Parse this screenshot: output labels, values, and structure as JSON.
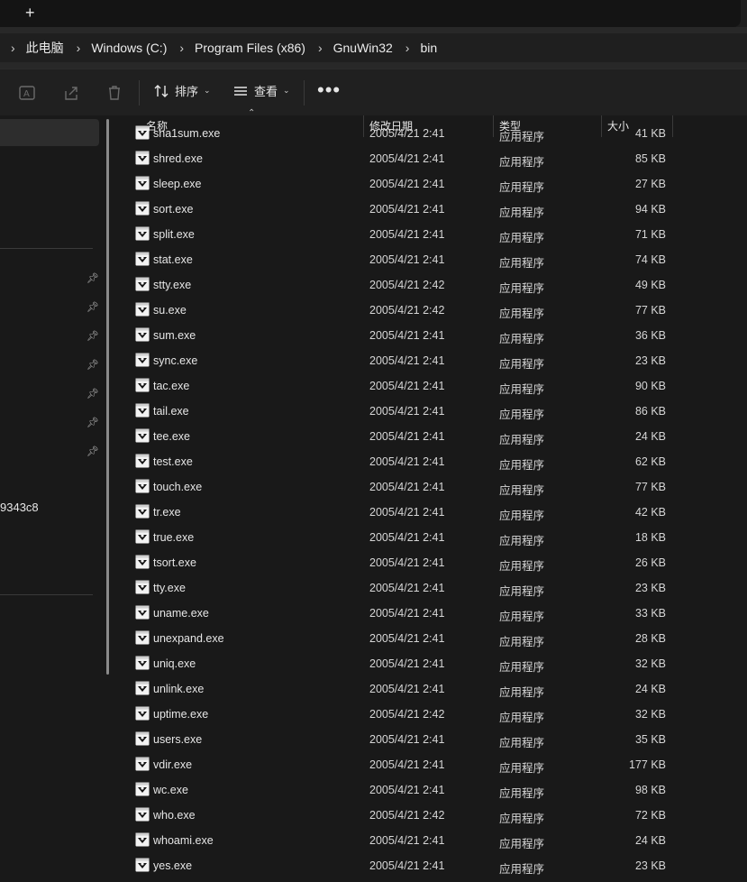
{
  "tabbar": {
    "new_tab_label": "+"
  },
  "breadcrumb": [
    "此电脑",
    "Windows (C:)",
    "Program Files (x86)",
    "GnuWin32",
    "bin"
  ],
  "toolbar": {
    "sort_label": "排序",
    "view_label": "查看",
    "more_label": "•••",
    "icons": [
      "rename-icon",
      "share-icon",
      "delete-icon",
      "sort-icon",
      "view-icon",
      "more-icon"
    ]
  },
  "sidebar": {
    "partial_text": "9343c8",
    "pin_icon": "pin-icon"
  },
  "columns": {
    "name": "名称",
    "date": "修改日期",
    "type": "类型",
    "size": "大小"
  },
  "files": [
    {
      "name": "sha1sum.exe",
      "date": "2005/4/21 2:41",
      "type": "应用程序",
      "size": "41 KB"
    },
    {
      "name": "shred.exe",
      "date": "2005/4/21 2:41",
      "type": "应用程序",
      "size": "85 KB"
    },
    {
      "name": "sleep.exe",
      "date": "2005/4/21 2:41",
      "type": "应用程序",
      "size": "27 KB"
    },
    {
      "name": "sort.exe",
      "date": "2005/4/21 2:41",
      "type": "应用程序",
      "size": "94 KB"
    },
    {
      "name": "split.exe",
      "date": "2005/4/21 2:41",
      "type": "应用程序",
      "size": "71 KB"
    },
    {
      "name": "stat.exe",
      "date": "2005/4/21 2:41",
      "type": "应用程序",
      "size": "74 KB"
    },
    {
      "name": "stty.exe",
      "date": "2005/4/21 2:42",
      "type": "应用程序",
      "size": "49 KB"
    },
    {
      "name": "su.exe",
      "date": "2005/4/21 2:42",
      "type": "应用程序",
      "size": "77 KB"
    },
    {
      "name": "sum.exe",
      "date": "2005/4/21 2:41",
      "type": "应用程序",
      "size": "36 KB"
    },
    {
      "name": "sync.exe",
      "date": "2005/4/21 2:41",
      "type": "应用程序",
      "size": "23 KB"
    },
    {
      "name": "tac.exe",
      "date": "2005/4/21 2:41",
      "type": "应用程序",
      "size": "90 KB"
    },
    {
      "name": "tail.exe",
      "date": "2005/4/21 2:41",
      "type": "应用程序",
      "size": "86 KB"
    },
    {
      "name": "tee.exe",
      "date": "2005/4/21 2:41",
      "type": "应用程序",
      "size": "24 KB"
    },
    {
      "name": "test.exe",
      "date": "2005/4/21 2:41",
      "type": "应用程序",
      "size": "62 KB"
    },
    {
      "name": "touch.exe",
      "date": "2005/4/21 2:41",
      "type": "应用程序",
      "size": "77 KB"
    },
    {
      "name": "tr.exe",
      "date": "2005/4/21 2:41",
      "type": "应用程序",
      "size": "42 KB"
    },
    {
      "name": "true.exe",
      "date": "2005/4/21 2:41",
      "type": "应用程序",
      "size": "18 KB"
    },
    {
      "name": "tsort.exe",
      "date": "2005/4/21 2:41",
      "type": "应用程序",
      "size": "26 KB"
    },
    {
      "name": "tty.exe",
      "date": "2005/4/21 2:41",
      "type": "应用程序",
      "size": "23 KB"
    },
    {
      "name": "uname.exe",
      "date": "2005/4/21 2:41",
      "type": "应用程序",
      "size": "33 KB"
    },
    {
      "name": "unexpand.exe",
      "date": "2005/4/21 2:41",
      "type": "应用程序",
      "size": "28 KB"
    },
    {
      "name": "uniq.exe",
      "date": "2005/4/21 2:41",
      "type": "应用程序",
      "size": "32 KB"
    },
    {
      "name": "unlink.exe",
      "date": "2005/4/21 2:41",
      "type": "应用程序",
      "size": "24 KB"
    },
    {
      "name": "uptime.exe",
      "date": "2005/4/21 2:42",
      "type": "应用程序",
      "size": "32 KB"
    },
    {
      "name": "users.exe",
      "date": "2005/4/21 2:41",
      "type": "应用程序",
      "size": "35 KB"
    },
    {
      "name": "vdir.exe",
      "date": "2005/4/21 2:41",
      "type": "应用程序",
      "size": "177 KB"
    },
    {
      "name": "wc.exe",
      "date": "2005/4/21 2:41",
      "type": "应用程序",
      "size": "98 KB"
    },
    {
      "name": "who.exe",
      "date": "2005/4/21 2:42",
      "type": "应用程序",
      "size": "72 KB"
    },
    {
      "name": "whoami.exe",
      "date": "2005/4/21 2:41",
      "type": "应用程序",
      "size": "24 KB"
    },
    {
      "name": "yes.exe",
      "date": "2005/4/21 2:41",
      "type": "应用程序",
      "size": "23 KB"
    }
  ]
}
